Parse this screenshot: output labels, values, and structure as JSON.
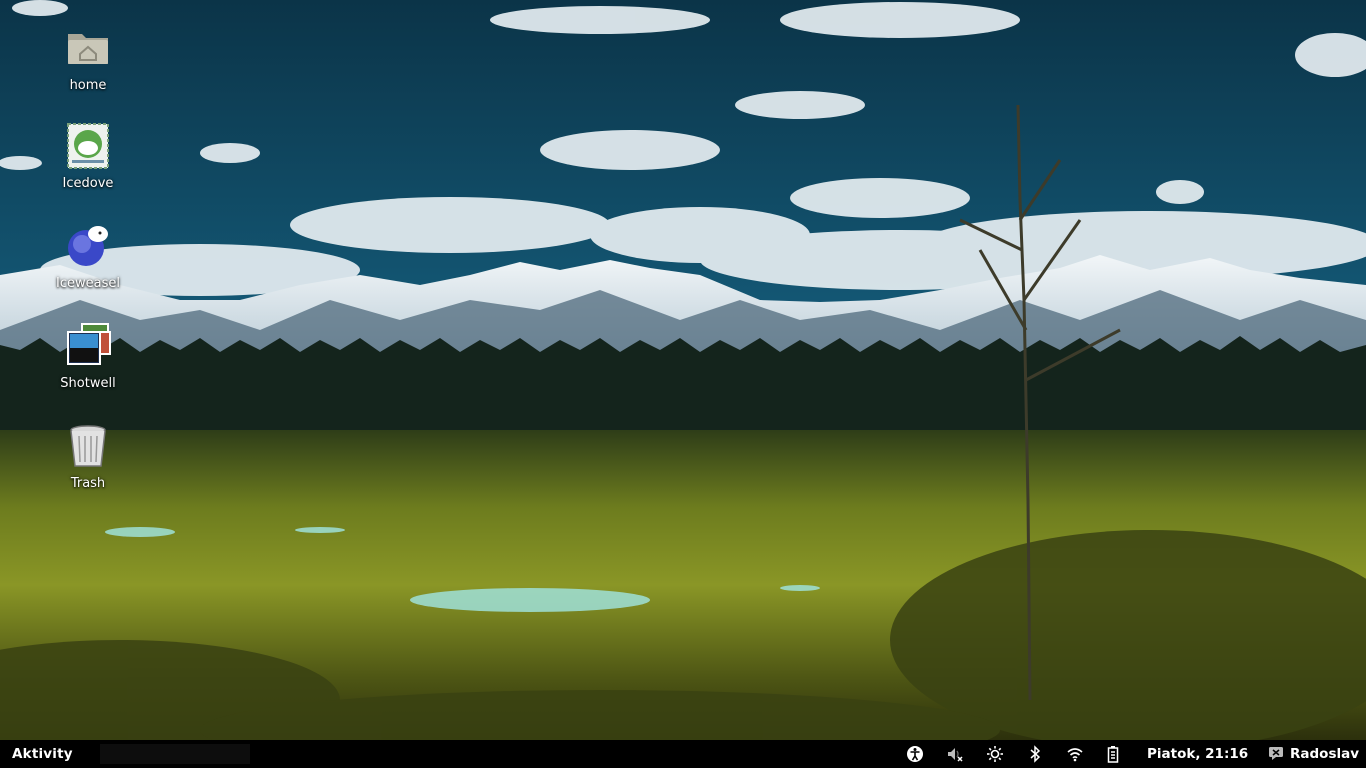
{
  "desktop": {
    "icons": [
      {
        "label": "home",
        "icon": "home-folder-icon"
      },
      {
        "label": "Icedove",
        "icon": "icedove-mail-icon"
      },
      {
        "label": "Iceweasel",
        "icon": "iceweasel-browser-icon"
      },
      {
        "label": "Shotwell",
        "icon": "shotwell-photos-icon"
      },
      {
        "label": "Trash",
        "icon": "trash-icon"
      }
    ]
  },
  "top_bar": {
    "activities_label": "Aktivity",
    "clock": "Piatok, 21:16",
    "user_name": "Radoslav",
    "tray_icons": [
      "accessibility-icon",
      "volume-muted-icon",
      "brightness-icon",
      "bluetooth-icon",
      "wifi-icon",
      "battery-icon"
    ]
  },
  "colors": {
    "panel_bg": "#000000",
    "panel_text": "#ffffff",
    "sky_top": "#0c3d55",
    "sky_bottom": "#2a7ea0"
  }
}
